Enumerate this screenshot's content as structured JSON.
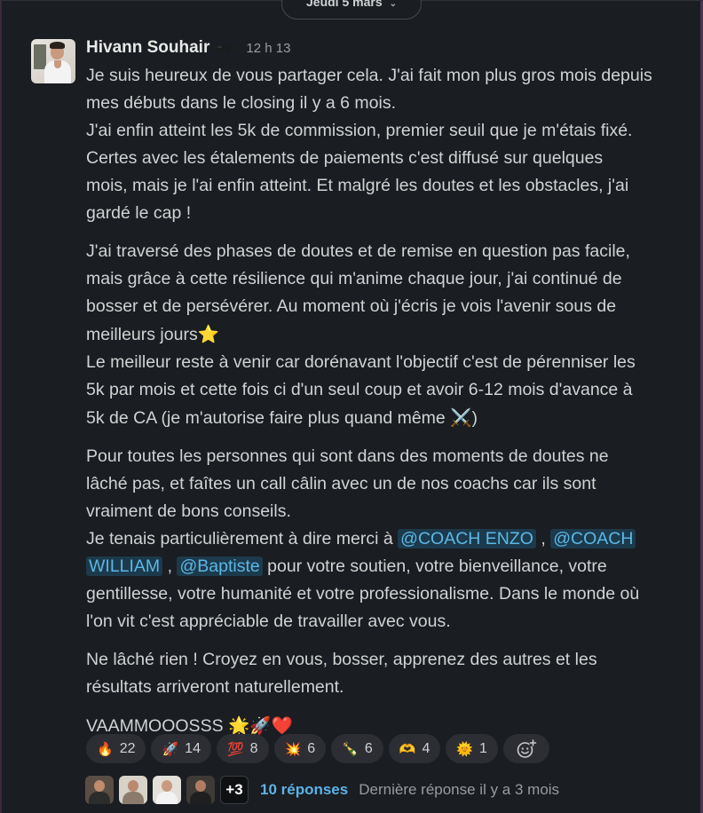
{
  "day_divider": {
    "label": "Jeudi 5 mars",
    "chevron_icon": "chevron-down-icon"
  },
  "message": {
    "author": "Hivann Souhair",
    "timestamp": "12 h 13",
    "status_icon": "sunglasses-icon",
    "avatar_icon": "user-avatar",
    "paragraphs": [
      {
        "lines": [
          "Je suis heureux de vous partager cela. J'ai fait mon plus gros mois depuis",
          "mes débuts dans le closing il y a 6 mois.",
          "J'ai enfin atteint les 5k de commission, premier seuil que je m'étais fixé.",
          "Certes avec les étalements de paiements c'est diffusé sur quelques",
          "mois, mais je l'ai enfin atteint. Et malgré les doutes et les obstacles, j'ai",
          "gardé le cap !"
        ]
      },
      {
        "lines": [
          "J'ai traversé des phases de doutes et de remise en question pas facile,",
          "mais grâce à cette résilience qui m'anime chaque jour, j'ai continué de",
          "bosser et de persévérer. Au moment où j'écris je vois l'avenir sous de"
        ],
        "line_with_emoji": {
          "text": "meilleurs jours",
          "emoji": "⭐"
        },
        "lines_after": [
          "Le meilleur reste à venir car dorénavant l'objectif c'est de pérenniser les",
          "5k par mois et cette fois ci d'un seul coup et avoir 6-12 mois d'avance à"
        ],
        "last_line": {
          "text": "5k de CA (je m'autorise faire plus quand même ",
          "emoji": "⚔️",
          "suffix": ")"
        }
      },
      {
        "lines": [
          "Pour toutes les personnes qui sont dans des moments de doutes ne",
          "lâché pas, et faîtes un call câlin avec un de nos coachs car ils sont",
          "vraiment de bons conseils."
        ],
        "thanks_prefix": "Je tenais particulièrement à dire merci à ",
        "mentions": [
          "@COACH ENZO",
          "@COACH",
          "WILLIAM",
          "@Baptiste"
        ],
        "comma": ",",
        "thanks_suffix": " pour votre soutien, votre bienveillance, votre",
        "lines_after": [
          "gentillesse, votre humanité et votre professionalisme. Dans le monde où",
          "l'on vit c'est appréciable de travailler avec vous."
        ]
      },
      {
        "lines": [
          "Ne lâché rien ! Croyez en vous, bosser, apprenez des autres et les",
          "résultats arriveront naturellement."
        ]
      },
      {
        "text": "VAAMMOOOSSS",
        "emojis": "🌟🚀❤️"
      }
    ]
  },
  "reactions": [
    {
      "emoji": "🔥",
      "count": "22",
      "icon": "fire-icon"
    },
    {
      "emoji": "🚀",
      "count": "14",
      "icon": "rocket-icon"
    },
    {
      "emoji": "💯",
      "count": "8",
      "icon": "hundred-icon"
    },
    {
      "emoji": "💥",
      "count": "6",
      "icon": "collision-icon"
    },
    {
      "emoji": "🍾",
      "count": "6",
      "icon": "champagne-icon"
    },
    {
      "emoji": "🫶",
      "count": "4",
      "icon": "heart-hands-icon"
    },
    {
      "emoji": "🌞",
      "count": "1",
      "icon": "sun-icon"
    }
  ],
  "add_reaction_icon": "add-reaction-icon",
  "thread": {
    "more_count": "+3",
    "replies_label": "10 réponses",
    "last_reply": "Dernière réponse il y a 3 mois"
  }
}
